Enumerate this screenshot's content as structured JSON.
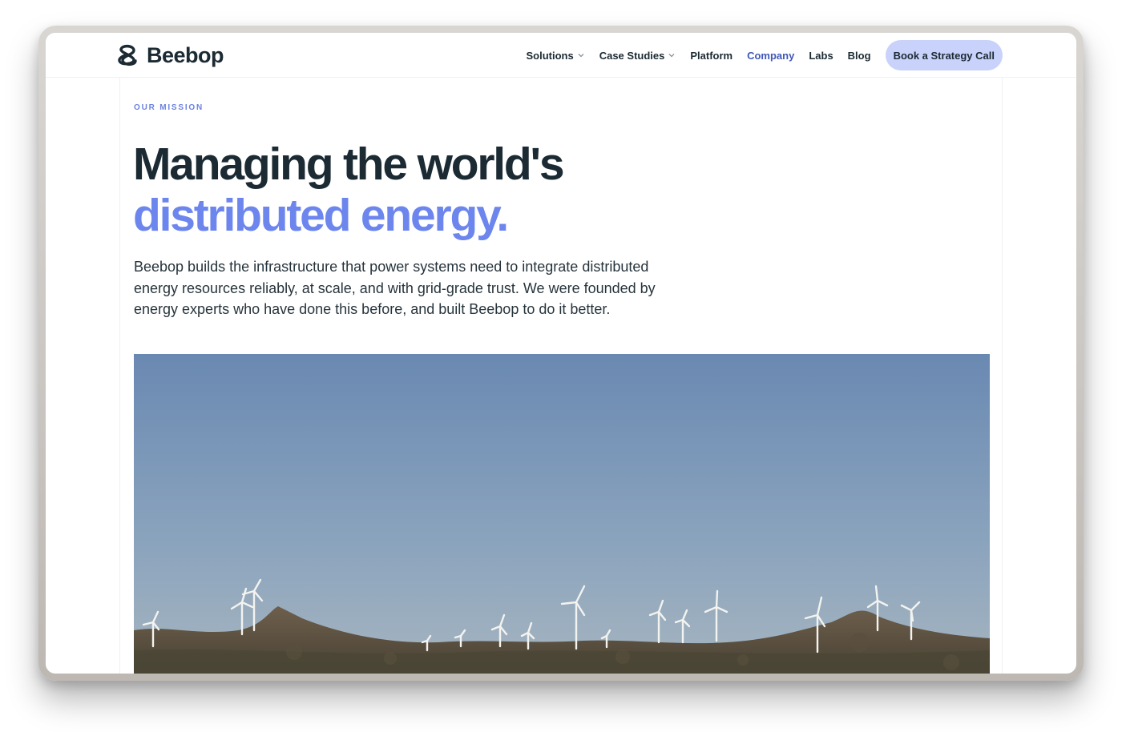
{
  "brand": {
    "name": "Beebop",
    "text_color": "#1b2a33",
    "accent_color": "#6d86ee",
    "cta_bg": "#c9d2fb"
  },
  "nav": {
    "items": [
      {
        "label": "Solutions",
        "has_dropdown": true
      },
      {
        "label": "Case Studies",
        "has_dropdown": true
      },
      {
        "label": "Platform",
        "has_dropdown": false
      },
      {
        "label": "Company",
        "has_dropdown": false,
        "active": true
      },
      {
        "label": "Labs",
        "has_dropdown": false
      },
      {
        "label": "Blog",
        "has_dropdown": false
      }
    ],
    "cta_label": "Book a Strategy Call"
  },
  "hero": {
    "eyebrow": "OUR MISSION",
    "headline_line1": "Managing the world's",
    "headline_line2": "distributed energy.",
    "lead": "Beebop builds the infrastructure that power systems need to integrate distributed energy resources reliably, at scale, and with grid-grade trust. We were founded by energy experts who have done this before, and built Beebop to do it better.",
    "image_icon": "wind-farm-photo"
  }
}
